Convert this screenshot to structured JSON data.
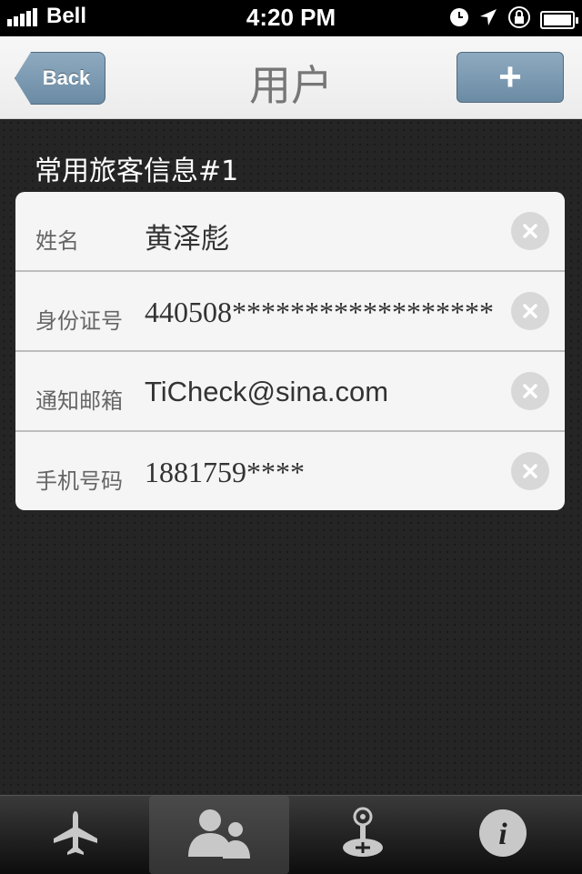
{
  "status_bar": {
    "carrier": "Bell",
    "time": "4:20 PM",
    "icons": [
      "signal-icon",
      "clock-icon",
      "location-icon",
      "rotation-lock-icon",
      "battery-icon"
    ]
  },
  "nav": {
    "back_label": "Back",
    "title": "用户",
    "add_icon": "plus-icon"
  },
  "section": {
    "title": "常用旅客信息#1"
  },
  "fields": [
    {
      "label": "姓名",
      "value": "黄泽彪"
    },
    {
      "label": "身份证号",
      "value": "440508******************"
    },
    {
      "label": "通知邮箱",
      "value": "TiCheck@sina.com"
    },
    {
      "label": "手机号码",
      "value": "1881759****"
    }
  ],
  "tabs": [
    {
      "icon": "airplane-icon",
      "active": false
    },
    {
      "icon": "users-icon",
      "active": true
    },
    {
      "icon": "joystick-icon",
      "active": false
    },
    {
      "icon": "info-icon",
      "active": false
    }
  ],
  "colors": {
    "accent": "#7b98b0",
    "background": "#252525",
    "card": "#f5f5f5"
  }
}
